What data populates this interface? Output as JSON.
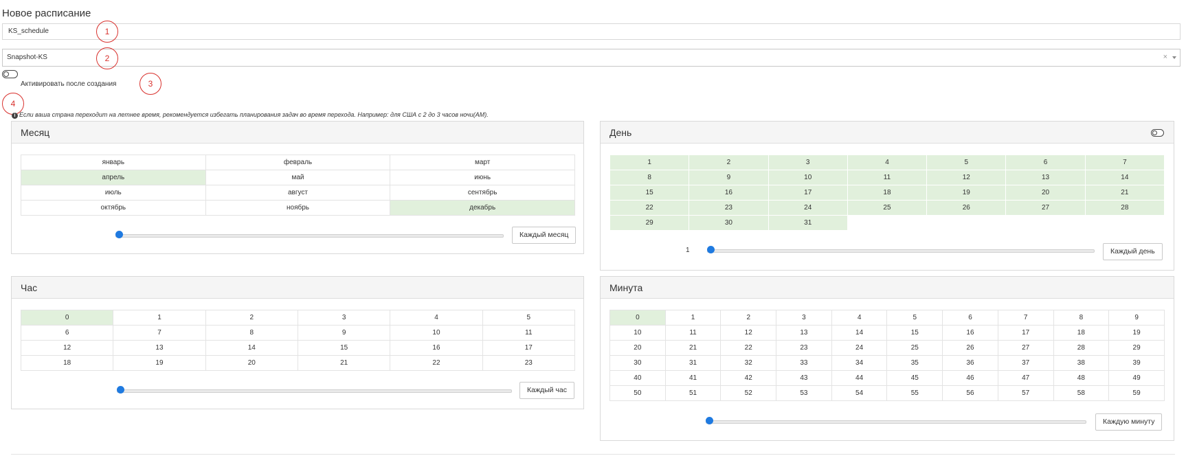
{
  "form": {
    "title": "Новое расписание",
    "name_value": "KS_schedule",
    "target_value": "Snapshot-KS",
    "clear_glyph": "×",
    "activate_label": "Активировать после создания",
    "dst_note": "Если ваша страна переходит на летнее время, рекомендуется избегать планирования задач во время перехода. Например: для США с 2 до 3 часов ночи(AM)."
  },
  "callouts": [
    "1",
    "2",
    "3",
    "4"
  ],
  "month": {
    "title": "Месяц",
    "rows": [
      [
        "январь",
        "февраль",
        "март"
      ],
      [
        "апрель",
        "май",
        "июнь"
      ],
      [
        "июль",
        "август",
        "сентябрь"
      ],
      [
        "октябрь",
        "ноябрь",
        "декабрь"
      ]
    ],
    "selected": [
      "апрель",
      "декабрь"
    ],
    "button": "Каждый месяц",
    "slider_fraction": 0
  },
  "day": {
    "title": "День",
    "rows": [
      [
        "1",
        "2",
        "3",
        "4",
        "5",
        "6",
        "7"
      ],
      [
        "8",
        "9",
        "10",
        "11",
        "12",
        "13",
        "14"
      ],
      [
        "15",
        "16",
        "17",
        "18",
        "19",
        "20",
        "21"
      ],
      [
        "22",
        "23",
        "24",
        "25",
        "26",
        "27",
        "28"
      ],
      [
        "29",
        "30",
        "31",
        "",
        "",
        "",
        ""
      ]
    ],
    "selected": [
      "1",
      "2",
      "3",
      "4",
      "5",
      "6",
      "7",
      "8",
      "9",
      "10",
      "11",
      "12",
      "13",
      "14",
      "15",
      "16",
      "17",
      "18",
      "19",
      "20",
      "21",
      "22",
      "23",
      "24",
      "25",
      "26",
      "27",
      "28",
      "29",
      "30",
      "31"
    ],
    "slider_value": "1",
    "button": "Каждый день",
    "slider_fraction": 0
  },
  "hour": {
    "title": "Час",
    "rows": [
      [
        "0",
        "1",
        "2",
        "3",
        "4",
        "5"
      ],
      [
        "6",
        "7",
        "8",
        "9",
        "10",
        "11"
      ],
      [
        "12",
        "13",
        "14",
        "15",
        "16",
        "17"
      ],
      [
        "18",
        "19",
        "20",
        "21",
        "22",
        "23"
      ]
    ],
    "selected": [
      "0"
    ],
    "button": "Каждый час",
    "slider_fraction": 0
  },
  "minute": {
    "title": "Минута",
    "rows": [
      [
        "0",
        "1",
        "2",
        "3",
        "4",
        "5",
        "6",
        "7",
        "8",
        "9"
      ],
      [
        "10",
        "11",
        "12",
        "13",
        "14",
        "15",
        "16",
        "17",
        "18",
        "19"
      ],
      [
        "20",
        "21",
        "22",
        "23",
        "24",
        "25",
        "26",
        "27",
        "28",
        "29"
      ],
      [
        "30",
        "31",
        "32",
        "33",
        "34",
        "35",
        "36",
        "37",
        "38",
        "39"
      ],
      [
        "40",
        "41",
        "42",
        "43",
        "44",
        "45",
        "46",
        "47",
        "48",
        "49"
      ],
      [
        "50",
        "51",
        "52",
        "53",
        "54",
        "55",
        "56",
        "57",
        "58",
        "59"
      ]
    ],
    "selected": [
      "0"
    ],
    "button": "Каждую минуту",
    "slider_fraction": 0
  },
  "colors": {
    "selected_cell": "#e1f0dc",
    "slider_thumb": "#1f7ae0",
    "callout": "#d8302c"
  },
  "icons": [
    "toggle-icon",
    "info-icon",
    "caret-down-icon",
    "clear-icon"
  ]
}
